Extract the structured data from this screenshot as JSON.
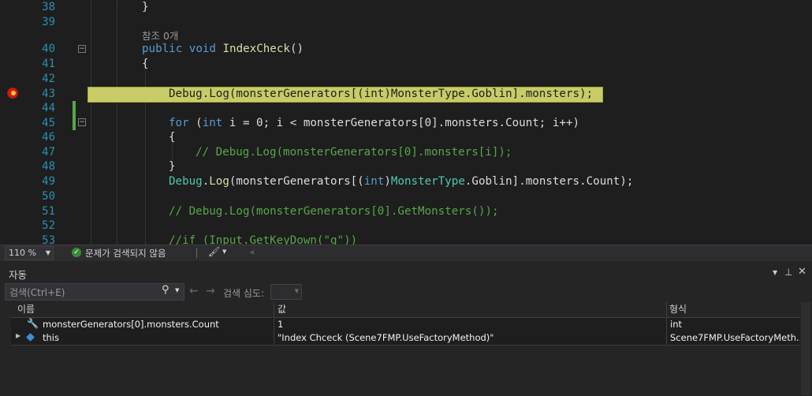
{
  "editor": {
    "line_numbers": [
      "38",
      "39",
      "40",
      "41",
      "42",
      "43",
      "44",
      "45",
      "46",
      "47",
      "48",
      "49",
      "50",
      "51",
      "52",
      "53"
    ],
    "brace_close_38": "}",
    "reference_lens": "참조 0개",
    "kw_public": "public",
    "kw_void": "void",
    "method_name": "IndexCheck",
    "method_parens": "()",
    "brace_open": "{",
    "line43": {
      "text": "Debug.Log(monsterGenerators[(int)MonsterType.Goblin].monsters);"
    },
    "line45": {
      "kw_for": "for",
      "paren_open": " (",
      "kw_int": "int",
      "rest": " i = 0; i < monsterGenerators[0].monsters.Count; i++)"
    },
    "line46": "{",
    "line47": "// Debug.Log(monsterGenerators[0].monsters[i]);",
    "line48": "}",
    "line49": {
      "debug": "Debug",
      "dot": ".",
      "log": "Log",
      "part1": "(monsterGenerators[(",
      "kw_int": "int",
      "part2": ")",
      "type": "MonsterType",
      "part3": ".Goblin].monsters.Count);"
    },
    "line51": "// Debug.Log(monsterGenerators[0].GetMonsters());",
    "line53": "//if (Input.GetKeyDown(\"g\"))"
  },
  "editor_status": {
    "zoom": "110 %",
    "issues": "문제가 검색되지 않음"
  },
  "autos": {
    "title": "자동",
    "search_placeholder": "검색(Ctrl+E)",
    "search_depth_label": "검색 심도:",
    "columns": [
      "이름",
      "값",
      "형식"
    ],
    "rows": [
      {
        "name": "monsterGenerators[0].monsters.Count",
        "value": "1",
        "type": "int"
      },
      {
        "name": "this",
        "value": "\"Index Chceck (Scene7FMP.UseFactoryMethod)\"",
        "type": "Scene7FMP.UseFactoryMeth..."
      }
    ]
  },
  "colors": {
    "keyword": "#569cd6",
    "type": "#4ec9b0",
    "method": "#dcdcaa",
    "comment": "#57a64a",
    "line_number": "#2b91af",
    "current_statement": "#c7cc67",
    "breakpoint": "#e51400"
  }
}
